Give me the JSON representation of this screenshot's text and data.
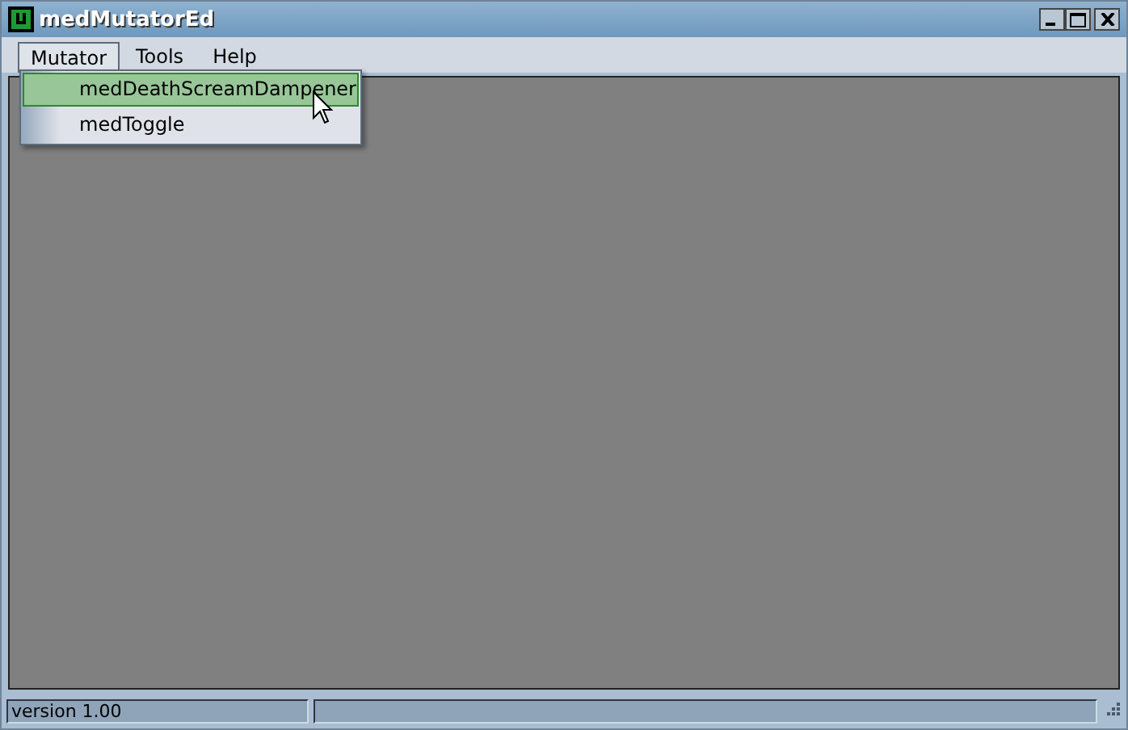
{
  "window": {
    "title": "medMutatorEd"
  },
  "menubar": [
    {
      "label": "Mutator",
      "selected": true
    },
    {
      "label": "Tools",
      "selected": false
    },
    {
      "label": "Help",
      "selected": false
    }
  ],
  "dropdown": [
    {
      "label": "medDeathScreamDampener",
      "selected": true
    },
    {
      "label": "medToggle",
      "selected": false
    }
  ],
  "status_bar": {
    "text": "version 1.00"
  }
}
